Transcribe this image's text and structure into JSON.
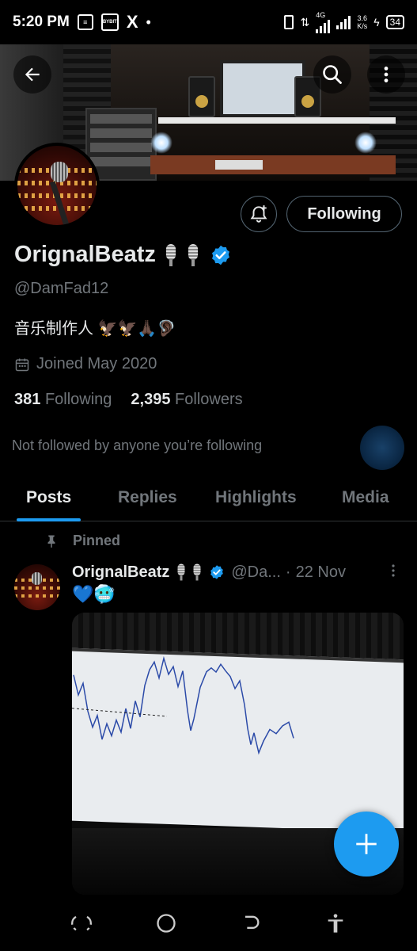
{
  "status_bar": {
    "time": "5:20 PM",
    "notif_bybit": "BYBIT",
    "notif_x": "X",
    "notif_dot": "•",
    "network_type": "4G",
    "speed_value": "3.6",
    "speed_unit": "K/s",
    "battery": "34"
  },
  "profile": {
    "display_name": "OrignalBeatz",
    "handle": "@DamFad12",
    "bio": "音乐制作人 🦅🦅🙏🏿🦻🏿",
    "joined": "Joined May 2020",
    "following_count": "381",
    "following_label": "Following",
    "followers_count": "2,395",
    "followers_label": "Followers",
    "not_followed": "Not followed by anyone you’re following",
    "follow_button": "Following"
  },
  "tabs": [
    {
      "label": "Posts",
      "active": true
    },
    {
      "label": "Replies",
      "active": false
    },
    {
      "label": "Highlights",
      "active": false
    },
    {
      "label": "Media",
      "active": false
    }
  ],
  "post": {
    "pinned_label": "Pinned",
    "author": "OrignalBeatz",
    "handle": "@Da...",
    "separator": "·",
    "date": "22 Nov",
    "text": "💙🥶"
  },
  "icons": {
    "back": "arrow-left-icon",
    "search": "search-icon",
    "more": "more-vertical-icon",
    "bell": "bell-plus-icon",
    "verified": "verified-badge-icon",
    "calendar": "calendar-icon",
    "pin": "pin-icon",
    "compose": "plus-icon"
  },
  "colors": {
    "accent": "#1d9bf0",
    "background": "#000000",
    "primary_text": "#e7e9ea",
    "secondary_text": "#71767b"
  }
}
